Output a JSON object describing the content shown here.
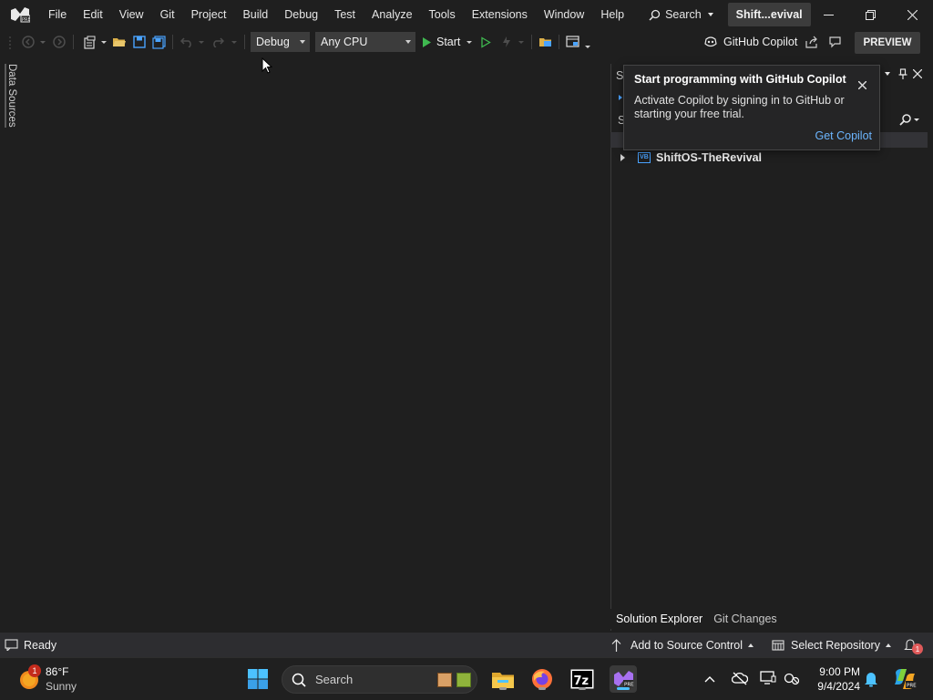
{
  "menu": {
    "items": [
      "File",
      "Edit",
      "View",
      "Git",
      "Project",
      "Build",
      "Debug",
      "Test",
      "Analyze",
      "Tools",
      "Extensions",
      "Window",
      "Help"
    ],
    "search_label": "Search",
    "solution_name": "Shift...evival"
  },
  "toolbar": {
    "config": "Debug",
    "platform": "Any CPU",
    "start_label": "Start",
    "copilot_label": "GitHub Copilot",
    "preview_label": "PREVIEW"
  },
  "left_strip": {
    "data_sources_label": "Data Sources"
  },
  "solution_explorer": {
    "header_partial": "S",
    "search_partial": "S",
    "project_name": "ShiftOS-TheRevival",
    "project_badge": "VB",
    "tabs": [
      "Solution Explorer",
      "Git Changes"
    ]
  },
  "copilot_popup": {
    "title": "Start programming with GitHub Copilot",
    "body": "Activate Copilot by signing in to GitHub or starting your free trial.",
    "link": "Get Copilot"
  },
  "status": {
    "ready": "Ready",
    "source_control": "Add to Source Control",
    "repository": "Select Repository",
    "notification_count": "1"
  },
  "taskbar": {
    "weather_temp": "86°F",
    "weather_desc": "Sunny",
    "weather_badge": "1",
    "search_placeholder": "Search",
    "time": "9:00 PM",
    "date": "9/4/2024"
  },
  "colors": {
    "background": "#1f1f1f",
    "accent_blue": "#4cc2ff",
    "link_blue": "#6cb6ff",
    "run_green": "#3fb950",
    "save_blue": "#4aa3ff",
    "folder_yellow": "#dcb04a"
  }
}
